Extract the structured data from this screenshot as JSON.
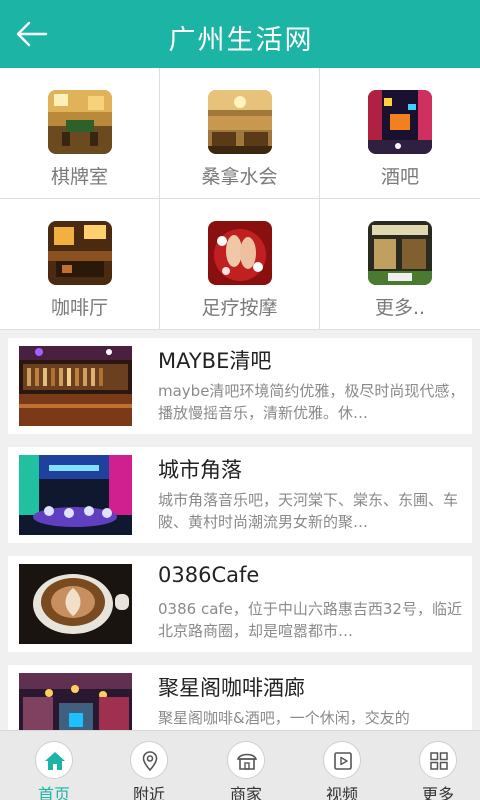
{
  "header": {
    "title": "广州生活网",
    "back_icon": "back-arrow-icon"
  },
  "categories": [
    {
      "label": "棋牌室"
    },
    {
      "label": "桑拿水会"
    },
    {
      "label": "酒吧"
    },
    {
      "label": "咖啡厅"
    },
    {
      "label": "足疗按摩"
    },
    {
      "label": "更多.."
    }
  ],
  "listings": [
    {
      "name": "MAYBE清吧",
      "desc": "maybe清吧环境简约优雅，极尽时尚现代感，播放慢摇音乐，清新优雅。休…"
    },
    {
      "name": "城市角落",
      "desc": "城市角落音乐吧，天河棠下、棠东、东圃、车陂、黄村时尚潮流男女新的聚…"
    },
    {
      "name": "0386Cafe",
      "desc": "0386 cafe，位于中山六路惠吉西32号，临近北京路商圈，却是喧嚣都市…"
    },
    {
      "name": "聚星阁咖啡酒廊",
      "desc": "聚星阁咖啡&酒吧，一个休闲，交友的"
    }
  ],
  "tabbar": {
    "accent": "#1cb4a4",
    "tabs": [
      {
        "label": "首页",
        "icon": "home-icon"
      },
      {
        "label": "附近",
        "icon": "location-pin-icon"
      },
      {
        "label": "商家",
        "icon": "shop-icon"
      },
      {
        "label": "视频",
        "icon": "video-play-icon"
      },
      {
        "label": "更多",
        "icon": "grid-more-icon"
      }
    ]
  }
}
